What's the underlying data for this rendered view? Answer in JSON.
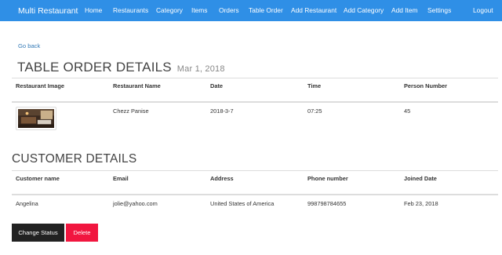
{
  "nav": {
    "brand": "Multi Restaurant",
    "links": [
      "Home",
      "Restaurants",
      "Category",
      "Items",
      "Orders",
      "Table Order",
      "Add Restaurant",
      "Add Category",
      "Add Item",
      "Settings"
    ],
    "logout": "Logout"
  },
  "back_link": "Go back",
  "table_order": {
    "title": "TABLE ORDER DETAILS",
    "date_sub": "Mar 1, 2018",
    "headers": [
      "Restaurant Image",
      "Restaurant Name",
      "Date",
      "Time",
      "Person Number"
    ],
    "row": {
      "image_icon": "restaurant-photo",
      "name": "Chezz Panise",
      "date": "2018-3-7",
      "time": "07:25",
      "persons": "45"
    }
  },
  "customer": {
    "title": "CUSTOMER DETAILS",
    "headers": [
      "Customer name",
      "Email",
      "Address",
      "Phone number",
      "Joined Date"
    ],
    "row": {
      "name": "Angelina",
      "email": "jolie@yahoo.com",
      "address": "United States of America",
      "phone": "998798784655",
      "joined": "Feb 23, 2018"
    }
  },
  "actions": {
    "change_status": "Change Status",
    "delete": "Delete"
  },
  "colors": {
    "navbar": "#2f8fe6",
    "delete": "#f1163f",
    "dark_button": "#222222",
    "link": "#337ab7"
  }
}
